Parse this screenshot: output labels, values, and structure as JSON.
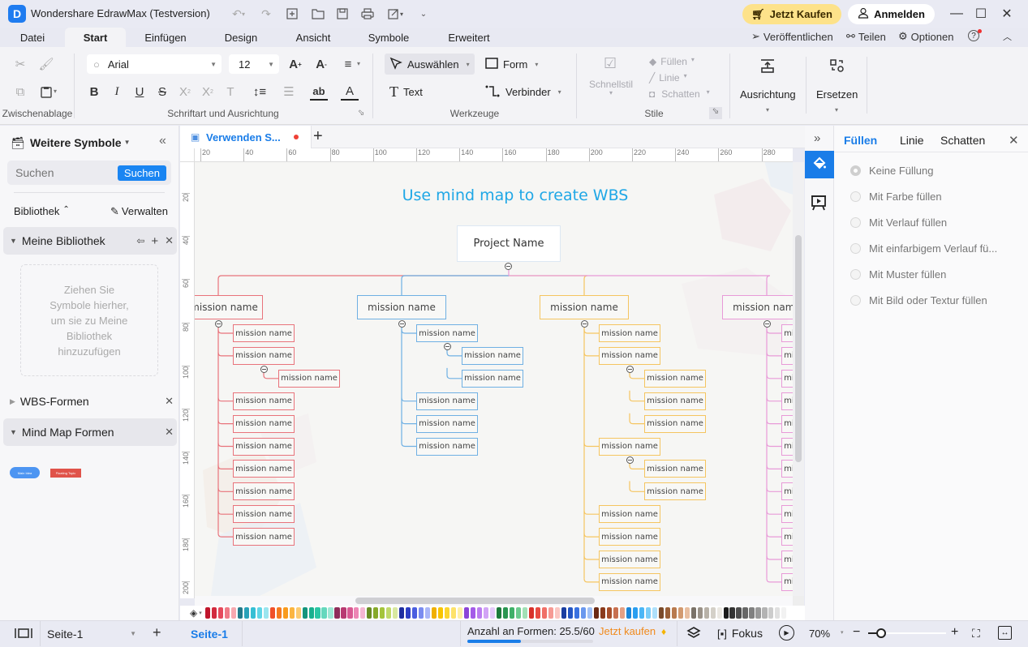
{
  "app": {
    "title": "Wondershare EdrawMax (Testversion)",
    "logo_letter": "D",
    "buy_label": "Jetzt Kaufen",
    "login_label": "Anmelden"
  },
  "menu": {
    "tabs": [
      "Datei",
      "Start",
      "Einfügen",
      "Design",
      "Ansicht",
      "Symbole",
      "Erweitert"
    ],
    "active": "Start",
    "right": {
      "publish": "Veröffentlichen",
      "share": "Teilen",
      "options": "Optionen"
    }
  },
  "ribbon": {
    "clipboard_label": "Zwischenablage",
    "font": {
      "family": "Arial",
      "size": "12",
      "group_label": "Schriftart und Ausrichtung"
    },
    "tools": {
      "select": "Auswählen",
      "shape": "Form",
      "text": "Text",
      "connector": "Verbinder",
      "group_label": "Werkzeuge"
    },
    "styles": {
      "quick_style": "Schnellstil",
      "fill": "Füllen",
      "line": "Linie",
      "shadow": "Schatten",
      "group_label": "Stile"
    },
    "align_label": "Ausrichtung",
    "replace_label": "Ersetzen"
  },
  "left_panel": {
    "title": "Weitere Symbole",
    "search_placeholder": "Suchen",
    "search_button": "Suchen",
    "library_label": "Bibliothek",
    "manage_label": "Verwalten",
    "my_library": "Meine Bibliothek",
    "drop_hint": "Ziehen Sie Symbole hierher, um sie zu Meine Bibliothek hinzuzufügen",
    "sections": [
      "WBS-Formen",
      "Mind Map Formen"
    ],
    "shape_previews": [
      "Main Idea",
      "Floating Topic"
    ]
  },
  "document": {
    "tab_title": "Verwenden S...",
    "ruler_h": [
      "20",
      "40",
      "60",
      "80",
      "100",
      "120",
      "140",
      "160",
      "180",
      "200",
      "220",
      "240",
      "260",
      "280"
    ],
    "ruler_v": [
      "20",
      "40",
      "60",
      "80",
      "100",
      "120",
      "140",
      "160",
      "180",
      "200"
    ]
  },
  "diagram": {
    "title": "Use mind map to create WBS",
    "root": "Project Name",
    "colors": {
      "red": "#e8737b",
      "blue": "#6fb0e3",
      "yellow": "#f5c560",
      "pink": "#e89ad8",
      "title": "#1fa7e6"
    },
    "branches": [
      {
        "label": "mission name",
        "color": "red",
        "children": [
          {
            "label": "mission name"
          },
          {
            "label": "mission name",
            "children": [
              {
                "label": "mission name"
              }
            ]
          },
          {
            "label": "mission name"
          },
          {
            "label": "mission name"
          },
          {
            "label": "mission name"
          },
          {
            "label": "mission name"
          },
          {
            "label": "mission name"
          },
          {
            "label": "mission name"
          },
          {
            "label": "mission name"
          }
        ]
      },
      {
        "label": "mission name",
        "color": "blue",
        "children": [
          {
            "label": "mission name",
            "children": [
              {
                "label": "mission name"
              },
              {
                "label": "mission name"
              }
            ]
          },
          {
            "label": "mission name"
          },
          {
            "label": "mission name"
          },
          {
            "label": "mission name"
          }
        ]
      },
      {
        "label": "mission name",
        "color": "yellow",
        "children": [
          {
            "label": "mission name"
          },
          {
            "label": "mission name",
            "children": [
              {
                "label": "mission name"
              },
              {
                "label": "mission name"
              },
              {
                "label": "mission name"
              }
            ]
          },
          {
            "label": "mission name",
            "children": [
              {
                "label": "mission name"
              },
              {
                "label": "mission name"
              }
            ]
          },
          {
            "label": "mission name"
          },
          {
            "label": "mission name"
          },
          {
            "label": "mission name"
          },
          {
            "label": "mission name"
          }
        ]
      },
      {
        "label": "mission name",
        "color": "pink",
        "children": [
          {
            "label": "mission name"
          },
          {
            "label": "mission name"
          },
          {
            "label": "mission name"
          },
          {
            "label": "mission name"
          },
          {
            "label": "mission name"
          },
          {
            "label": "mission name"
          },
          {
            "label": "mission name"
          },
          {
            "label": "mission name"
          },
          {
            "label": "mission name"
          },
          {
            "label": "mission name"
          },
          {
            "label": "mission name"
          },
          {
            "label": "mission name"
          }
        ]
      }
    ]
  },
  "right_panel": {
    "tabs": [
      "Füllen",
      "Linie",
      "Schatten"
    ],
    "active_tab": "Füllen",
    "fill_options": [
      "Keine Füllung",
      "Mit Farbe füllen",
      "Mit Verlauf füllen",
      "Mit einfarbigem Verlauf fü...",
      "Mit Muster füllen",
      "Mit Bild oder Textur füllen"
    ],
    "selected_fill": "Keine Füllung"
  },
  "palette": [
    "#c0162c",
    "#d22a3e",
    "#e64a5c",
    "#f07a86",
    "#f7a9b0",
    "#237a8a",
    "#2aa2b8",
    "#36bfd4",
    "#5fd5e6",
    "#9ae5ef",
    "#f0502a",
    "#f57a20",
    "#f99b1e",
    "#fbb540",
    "#fccb70",
    "#14957d",
    "#19b08f",
    "#2bc6a4",
    "#64d8bd",
    "#9ee8d5",
    "#8e2d5a",
    "#b83a72",
    "#d85a93",
    "#ed86b5",
    "#f5b6d2",
    "#6a8c24",
    "#86a92a",
    "#a4c43b",
    "#c0d96a",
    "#d8e8a0",
    "#1f2ea0",
    "#2d3ec4",
    "#4a5ee0",
    "#7a8cf0",
    "#aab6f8",
    "#f0b000",
    "#f8c400",
    "#fbd530",
    "#fde26a",
    "#fef0a6",
    "#8b45d8",
    "#a45be8",
    "#bb7cf0",
    "#d2a4f6",
    "#e6cafa",
    "#1e7a3c",
    "#2a9550",
    "#3fb068",
    "#6ccb8e",
    "#a2e0b6",
    "#d8302a",
    "#e84a42",
    "#f07068",
    "#f69a94",
    "#fbc6c2",
    "#1a3ea0",
    "#2456c4",
    "#3a72e0",
    "#6a98ee",
    "#a0c0f6",
    "#6a2a14",
    "#8a3a1c",
    "#a84e2a",
    "#c87050",
    "#e4a084",
    "#1a86d8",
    "#2a9ef0",
    "#4ab6f6",
    "#7acdf8",
    "#aee0fb",
    "#7a4a2a",
    "#9a6038",
    "#b87a4e",
    "#d29a70",
    "#e8bea0",
    "#7a7268",
    "#9a9288",
    "#b8b2a8",
    "#d4d0c8",
    "#ebe8e2",
    "#1a1a1a",
    "#333333",
    "#4d4d4d",
    "#666666",
    "#808080",
    "#999999",
    "#b3b3b3",
    "#cccccc",
    "#e0e0e0",
    "#f2f2f2"
  ],
  "status": {
    "page_dropdown": "Seite-1",
    "active_page_tab": "Seite-1",
    "shape_count_label": "Anzahl an Formen: 25.5/60",
    "shape_count_fraction": 0.425,
    "buy_now": "Jetzt kaufen",
    "focus_label": "Fokus",
    "zoom_level": "70%",
    "zoom_fraction": 0.15
  }
}
